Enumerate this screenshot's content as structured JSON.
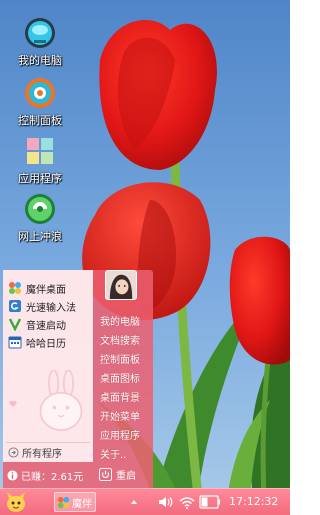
{
  "desktop": {
    "icons": [
      {
        "label": "我的电脑",
        "icon": "my-computer-icon"
      },
      {
        "label": "控制面板",
        "icon": "control-panel-icon"
      },
      {
        "label": "应用程序",
        "icon": "applications-icon"
      },
      {
        "label": "网上冲浪",
        "icon": "internet-icon"
      }
    ]
  },
  "start_menu": {
    "programs": [
      {
        "label": "魔伴桌面",
        "icon": "mobile-desktop-icon"
      },
      {
        "label": "光速输入法",
        "icon": "input-method-icon"
      },
      {
        "label": "音速启动",
        "icon": "launcher-icon"
      },
      {
        "label": "哈哈日历",
        "icon": "calendar-icon"
      }
    ],
    "all_programs": "所有程序",
    "links": [
      "我的电脑",
      "文档搜索",
      "控制面板",
      "桌面图标",
      "桌面背景",
      "开始菜单",
      "应用程序",
      "关于.."
    ],
    "earned": "已赚：2.61元",
    "restart": "重启"
  },
  "taskbar": {
    "app_label": "魔伴",
    "clock": "17:12:32"
  },
  "colors": {
    "menu_accent": "#ec6070",
    "taskbar": "#f26b7e",
    "sky": "#5f95d2"
  }
}
